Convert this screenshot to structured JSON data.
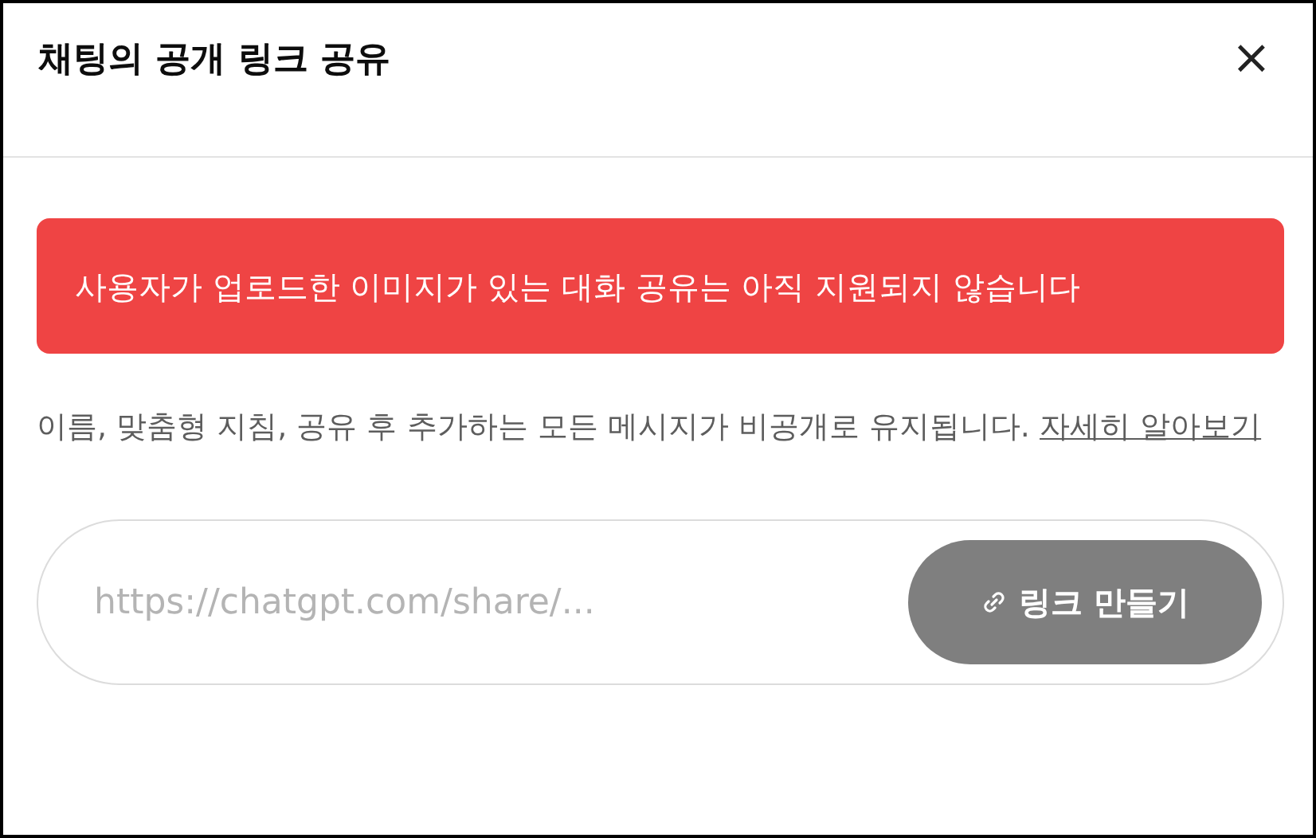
{
  "dialog": {
    "title": "채팅의 공개 링크 공유",
    "close": "×"
  },
  "alert": {
    "text": "사용자가 업로드한 이미지가 있는 대화 공유는 아직 지원되지 않습니다"
  },
  "description": {
    "text": "이름, 맞춤형 지침, 공유 후 추가하는 모든 메시지가 비공개로 유지됩니다.",
    "link": "자세히 알아보기"
  },
  "share": {
    "placeholder": "https://chatgpt.com/share/...",
    "button": "링크 만들기",
    "disabled": true
  }
}
